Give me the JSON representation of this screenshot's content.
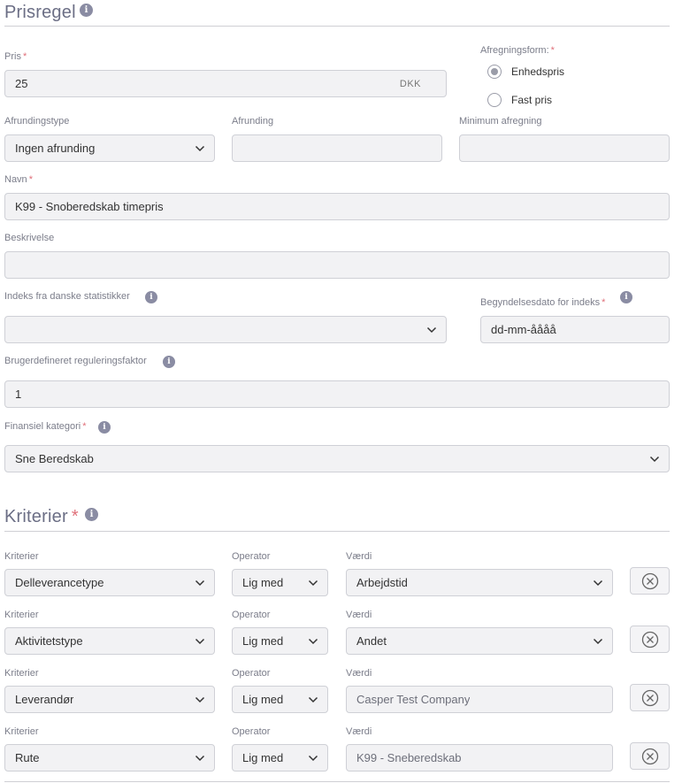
{
  "prisregel": {
    "title": "Prisregel",
    "pris": {
      "label": "Pris",
      "value": "25",
      "suffix": "DKK"
    },
    "afregningsform": {
      "label": "Afregningsform:",
      "options": [
        {
          "label": "Enhedspris",
          "checked": true
        },
        {
          "label": "Fast pris",
          "checked": false
        }
      ]
    },
    "afrundingstype": {
      "label": "Afrundingstype",
      "value": "Ingen afrunding"
    },
    "afrunding": {
      "label": "Afrunding",
      "value": ""
    },
    "minimum_afregning": {
      "label": "Minimum afregning",
      "value": ""
    },
    "navn": {
      "label": "Navn",
      "value": "K99 - Snoberedskab timepris"
    },
    "beskrivelse": {
      "label": "Beskrivelse",
      "value": ""
    },
    "indeks": {
      "label": "Indeks fra danske statistikker",
      "value": ""
    },
    "begyndelsesdato": {
      "label": "Begyndelsesdato for indeks",
      "placeholder": "dd-mm-åååå"
    },
    "reguleringsfaktor": {
      "label": "Brugerdefineret reguleringsfaktor",
      "value": "1"
    },
    "finansiel_kategori": {
      "label": "Finansiel kategori",
      "value": "Sne Beredskab"
    }
  },
  "kriterier": {
    "title": "Kriterier",
    "col_labels": {
      "kriterier": "Kriterier",
      "operator": "Operator",
      "vaerdi": "Værdi"
    },
    "rows": [
      {
        "kriterie": "Delleverancetype",
        "operator": "Lig med",
        "vaerdi": "Arbejdstid",
        "vaerdi_dropdown": true
      },
      {
        "kriterie": "Aktivitetstype",
        "operator": "Lig med",
        "vaerdi": "Andet",
        "vaerdi_dropdown": true
      },
      {
        "kriterie": "Leverandør",
        "operator": "Lig med",
        "vaerdi": "Casper Test Company",
        "vaerdi_dropdown": false
      },
      {
        "kriterie": "Rute",
        "operator": "Lig med",
        "vaerdi": "K99 - Sneberedskab",
        "vaerdi_dropdown": false
      }
    ]
  },
  "icons": {
    "info": "info-icon",
    "chevron": "chevron-down-icon",
    "remove": "close-circle-icon"
  },
  "colors": {
    "required": "#e0707a",
    "field_bg": "#f2f2f4",
    "title": "#6b6e85"
  }
}
